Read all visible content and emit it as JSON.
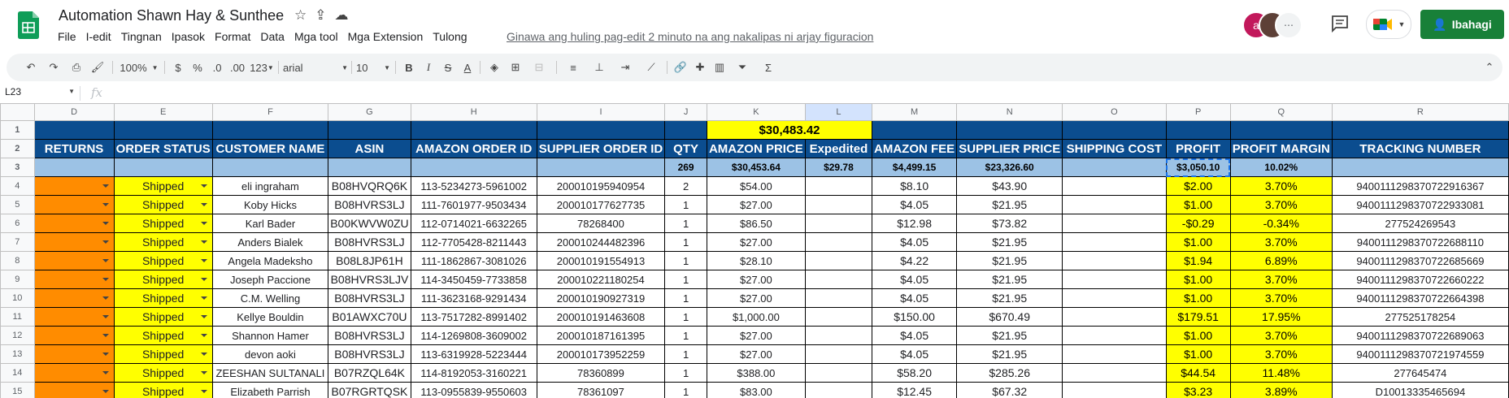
{
  "doc": {
    "title": "Automation Shawn Hay & Sunthee",
    "last_edit": "Ginawa ang huling pag-edit 2 minuto na ang nakalipas ni arjay figuracion"
  },
  "menu": [
    "File",
    "I-edit",
    "Tingnan",
    "Ipasok",
    "Format",
    "Data",
    "Mga tool",
    "Mga Extension",
    "Tulong"
  ],
  "avatar_letter": "a",
  "share_label": "Ibahagi",
  "toolbar": {
    "zoom": "100%",
    "currency": "$",
    "percent": "%",
    "dec_less": ".0",
    "dec_more": ".00",
    "number_format": "123",
    "font": "arial",
    "font_size": "10",
    "bold": "B",
    "italic": "I",
    "strike": "S",
    "text_color": "A"
  },
  "formula": {
    "cell_ref": "L23",
    "fx": "fx",
    "value": ""
  },
  "columns": [
    "D",
    "E",
    "F",
    "G",
    "H",
    "I",
    "J",
    "K",
    "L",
    "M",
    "N",
    "O",
    "P",
    "Q",
    "R"
  ],
  "total_amazon_price": "$30,483.42",
  "headers": [
    "RETURNS",
    "ORDER STATUS",
    "CUSTOMER NAME",
    "ASIN",
    "AMAZON ORDER ID",
    "SUPPLIER ORDER ID",
    "QTY",
    "AMAZON PRICE",
    "Expedited",
    "AMAZON FEE",
    "SUPPLIER PRICE",
    "SHIPPING COST",
    "PROFIT",
    "PROFIT MARGIN",
    "TRACKING NUMBER"
  ],
  "totals": {
    "qty": "269",
    "amazon_price": "$30,453.64",
    "expedited": "$29.78",
    "amazon_fee": "$4,499.15",
    "supplier_price": "$23,326.60",
    "profit": "$3,050.10",
    "margin": "10.02%"
  },
  "rows": [
    {
      "n": "4",
      "status": "Shipped",
      "name": "eli ingraham",
      "asin": "B08HVQRQ6K",
      "aoid": "113-5234273-5961002",
      "soid": "200010195940954",
      "qty": "2",
      "price": "$54.00",
      "exp": "",
      "fee": "$8.10",
      "sup": "$43.90",
      "ship": "",
      "profit": "$2.00",
      "margin": "3.70%",
      "track": "9400111298370722916367"
    },
    {
      "n": "5",
      "status": "Shipped",
      "name": "Koby Hicks",
      "asin": "B08HVRS3LJ",
      "aoid": "111-7601977-9503434",
      "soid": "200010177627735",
      "qty": "1",
      "price": "$27.00",
      "exp": "",
      "fee": "$4.05",
      "sup": "$21.95",
      "ship": "",
      "profit": "$1.00",
      "margin": "3.70%",
      "track": "9400111298370722933081"
    },
    {
      "n": "6",
      "status": "Shipped",
      "name": "Karl Bader",
      "asin": "B00KWVW0ZU",
      "aoid": "112-0714021-6632265",
      "soid": "78268400",
      "qty": "1",
      "price": "$86.50",
      "exp": "",
      "fee": "$12.98",
      "sup": "$73.82",
      "ship": "",
      "profit": "-$0.29",
      "margin": "-0.34%",
      "track": "277524269543"
    },
    {
      "n": "7",
      "status": "Shipped",
      "name": "Anders Bialek",
      "asin": "B08HVRS3LJ",
      "aoid": "112-7705428-8211443",
      "soid": "200010244482396",
      "qty": "1",
      "price": "$27.00",
      "exp": "",
      "fee": "$4.05",
      "sup": "$21.95",
      "ship": "",
      "profit": "$1.00",
      "margin": "3.70%",
      "track": "9400111298370722688110"
    },
    {
      "n": "8",
      "status": "Shipped",
      "name": "Angela Madeksho",
      "asin": "B08L8JP61H",
      "aoid": "111-1862867-3081026",
      "soid": "200010191554913",
      "qty": "1",
      "price": "$28.10",
      "exp": "",
      "fee": "$4.22",
      "sup": "$21.95",
      "ship": "",
      "profit": "$1.94",
      "margin": "6.89%",
      "track": "9400111298370722685669"
    },
    {
      "n": "9",
      "status": "Shipped",
      "name": "Joseph Paccione",
      "asin": "B08HVRS3LJV",
      "aoid": "114-3450459-7733858",
      "soid": "200010221180254",
      "qty": "1",
      "price": "$27.00",
      "exp": "",
      "fee": "$4.05",
      "sup": "$21.95",
      "ship": "",
      "profit": "$1.00",
      "margin": "3.70%",
      "track": "9400111298370722660222"
    },
    {
      "n": "10",
      "status": "Shipped",
      "name": "C.M. Welling",
      "asin": "B08HVRS3LJ",
      "aoid": "111-3623168-9291434",
      "soid": "200010190927319",
      "qty": "1",
      "price": "$27.00",
      "exp": "",
      "fee": "$4.05",
      "sup": "$21.95",
      "ship": "",
      "profit": "$1.00",
      "margin": "3.70%",
      "track": "9400111298370722664398"
    },
    {
      "n": "11",
      "status": "Shipped",
      "name": "Kellye Bouldin",
      "asin": "B01AWXC70U",
      "aoid": "113-7517282-8991402",
      "soid": "200010191463608",
      "qty": "1",
      "price": "$1,000.00",
      "exp": "",
      "fee": "$150.00",
      "sup": "$670.49",
      "ship": "",
      "profit": "$179.51",
      "margin": "17.95%",
      "track": "277525178254"
    },
    {
      "n": "12",
      "status": "Shipped",
      "name": "Shannon Hamer",
      "asin": "B08HVRS3LJ",
      "aoid": "114-1269808-3609002",
      "soid": "200010187161395",
      "qty": "1",
      "price": "$27.00",
      "exp": "",
      "fee": "$4.05",
      "sup": "$21.95",
      "ship": "",
      "profit": "$1.00",
      "margin": "3.70%",
      "track": "9400111298370722689063"
    },
    {
      "n": "13",
      "status": "Shipped",
      "name": "devon aoki",
      "asin": "B08HVRS3LJ",
      "aoid": "113-6319928-5223444",
      "soid": "200010173952259",
      "qty": "1",
      "price": "$27.00",
      "exp": "",
      "fee": "$4.05",
      "sup": "$21.95",
      "ship": "",
      "profit": "$1.00",
      "margin": "3.70%",
      "track": "9400111298370721974559"
    },
    {
      "n": "14",
      "status": "Shipped",
      "name": "ZEESHAN SULTANALI",
      "asin": "B07RZQL64K",
      "aoid": "114-8192053-3160221",
      "soid": "78360899",
      "qty": "1",
      "price": "$388.00",
      "exp": "",
      "fee": "$58.20",
      "sup": "$285.26",
      "ship": "",
      "profit": "$44.54",
      "margin": "11.48%",
      "track": "277645474"
    },
    {
      "n": "15",
      "status": "Shipped",
      "name": "Elizabeth Parrish",
      "asin": "B07RGRTQSK",
      "aoid": "113-0955839-9550603",
      "soid": "78361097",
      "qty": "1",
      "price": "$83.00",
      "exp": "",
      "fee": "$12.45",
      "sup": "$67.32",
      "ship": "",
      "profit": "$3.23",
      "margin": "3.89%",
      "track": "D10013335465694"
    }
  ],
  "colors": {
    "header_blue": "#0b4d8f",
    "totals_blue": "#9cc2e5",
    "yellow": "#ffff00",
    "orange": "#ff8c00",
    "share_green": "#188038"
  }
}
